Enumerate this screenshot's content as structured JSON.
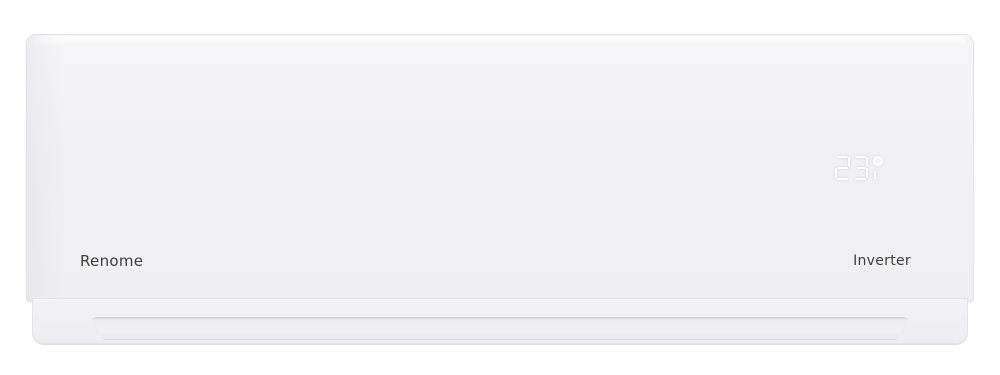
{
  "product": {
    "brand": "Renome",
    "badge": "Inverter",
    "display_temperature": "23",
    "display_unit": "°"
  },
  "colors": {
    "body": "#f1f1f3",
    "text": "#3d3d40",
    "display": "#ffffff"
  }
}
